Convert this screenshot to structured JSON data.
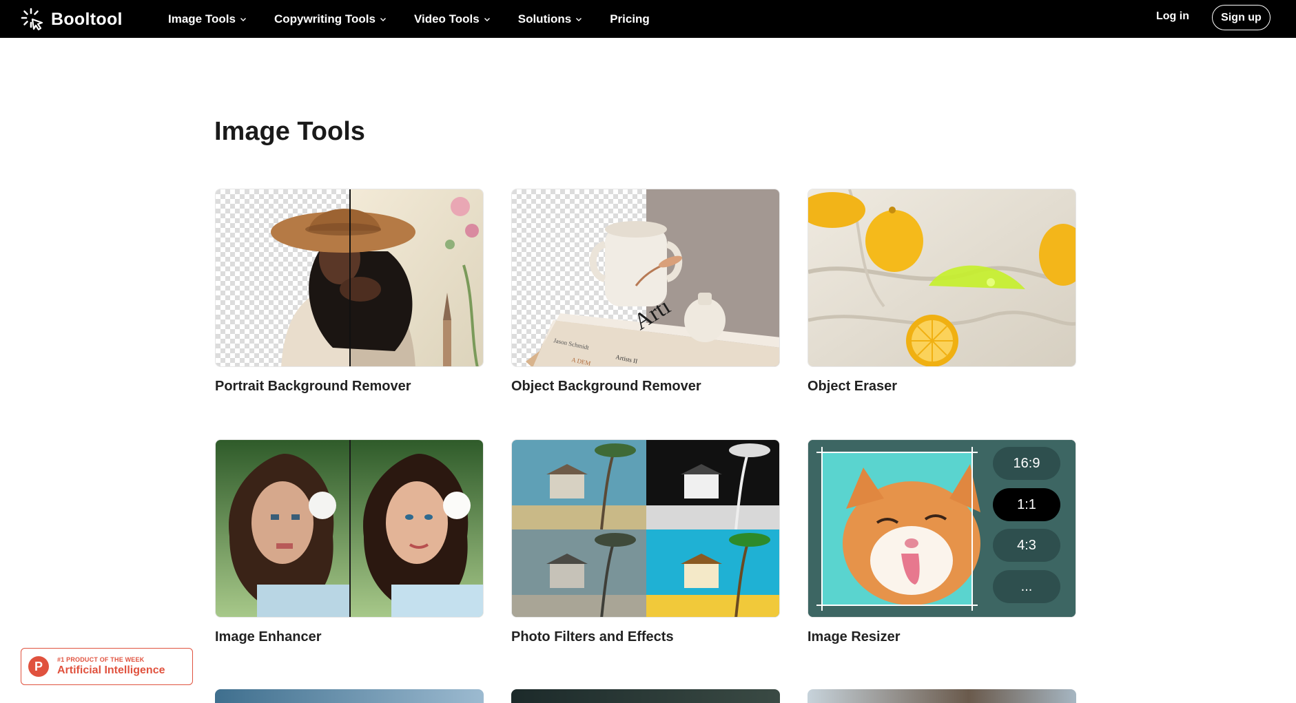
{
  "brand": {
    "name": "Booltool",
    "icon": "sparkle-cursor-icon"
  },
  "nav": {
    "items": [
      {
        "label": "Image Tools",
        "has_dropdown": true
      },
      {
        "label": "Copywriting Tools",
        "has_dropdown": true
      },
      {
        "label": "Video Tools",
        "has_dropdown": true
      },
      {
        "label": "Solutions",
        "has_dropdown": true
      },
      {
        "label": "Pricing",
        "has_dropdown": false
      }
    ],
    "login_label": "Log in",
    "signup_label": "Sign up"
  },
  "main": {
    "title": "Image Tools",
    "tools": [
      {
        "label": "Portrait Background Remover"
      },
      {
        "label": "Object Background Remover"
      },
      {
        "label": "Object Eraser"
      },
      {
        "label": "Image Enhancer"
      },
      {
        "label": "Photo Filters and Effects"
      },
      {
        "label": "Image Resizer"
      }
    ],
    "resizer_options": [
      "16:9",
      "1:1",
      "4:3",
      "..."
    ],
    "resizer_selected": "1:1",
    "mockup_text": {
      "book_title": "Arti",
      "book_author": "Jason Schmidt",
      "book_sub": "Artists II",
      "book_spine2": "A DEM"
    }
  },
  "badge": {
    "logo_letter": "P",
    "small_text": "#1 PRODUCT OF THE WEEK",
    "main_text": "Artificial Intelligence"
  },
  "colors": {
    "nav_bg": "#000000",
    "accent": "#e0523e"
  }
}
